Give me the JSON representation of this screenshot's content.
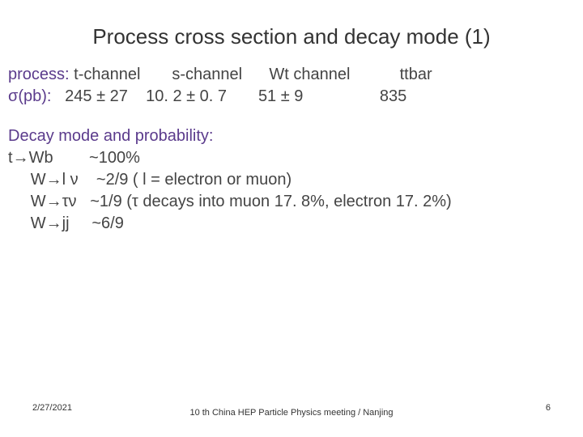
{
  "title": "Process cross section and decay mode (1)",
  "process": {
    "label": "process:",
    "cols": {
      "c1": "t-channel",
      "c2": "s-channel",
      "c3": "Wt channel",
      "c4": "ttbar"
    }
  },
  "sigma": {
    "label": "σ(pb):",
    "vals": {
      "v1": "245 ± 27",
      "v2": "10. 2 ± 0. 7",
      "v3": "51 ± 9",
      "v4": "835"
    }
  },
  "decay": {
    "header": "Decay mode and probability:",
    "lines": {
      "l1a": "t",
      "l1arrow": "→",
      "l1b": "Wb        ~100%",
      "l2": "     W→l ν    ~2/9 ( l = electron or muon)",
      "l3": "     W→τν   ~1/9 (τ decays into muon 17. 8%, electron 17. 2%)",
      "l4": "     W→jj     ~6/9"
    }
  },
  "footer": {
    "date": "2/27/2021",
    "center": "10 th China HEP Particle Physics meeting / Nanjing",
    "page": "6"
  }
}
